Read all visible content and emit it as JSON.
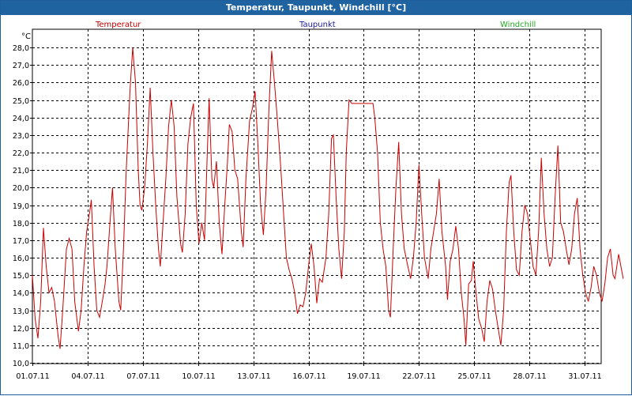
{
  "window": {
    "title": "Temperatur, Taupunkt, Windchill [°C]"
  },
  "colors": {
    "temperature": "#cc0000",
    "dewpoint": "#1a1aa0",
    "windchill": "#22aa22",
    "titlebar": "#1f63a0"
  },
  "chart_data": {
    "type": "line",
    "ylabel": "°C",
    "ylim": [
      10.0,
      28.5
    ],
    "yticks": [
      "10,0",
      "11,0",
      "12,0",
      "13,0",
      "14,0",
      "15,0",
      "16,0",
      "17,0",
      "18,0",
      "19,0",
      "20,0",
      "21,0",
      "22,0",
      "23,0",
      "24,0",
      "25,0",
      "26,0",
      "27,0",
      "28,0"
    ],
    "xticks": [
      "01.07.11",
      "04.07.11",
      "07.07.11",
      "10.07.11",
      "13.07.11",
      "16.07.11",
      "19.07.11",
      "22.07.11",
      "25.07.11",
      "28.07.11",
      "31.07.11"
    ],
    "xlim_days": [
      0,
      32.2
    ],
    "grid": true,
    "legend": [
      "Temperatur",
      "Taupunkt",
      "Windchill"
    ],
    "series": [
      {
        "name": "Temperatur",
        "points": [
          [
            0.0,
            15.0
          ],
          [
            0.15,
            12.5
          ],
          [
            0.3,
            11.4
          ],
          [
            0.45,
            13.5
          ],
          [
            0.6,
            17.7
          ],
          [
            0.75,
            15.5
          ],
          [
            0.9,
            14.0
          ],
          [
            1.05,
            14.3
          ],
          [
            1.2,
            13.5
          ],
          [
            1.4,
            11.5
          ],
          [
            1.5,
            10.8
          ],
          [
            1.65,
            13.0
          ],
          [
            1.85,
            16.5
          ],
          [
            2.0,
            17.1
          ],
          [
            2.15,
            16.5
          ],
          [
            2.3,
            13.5
          ],
          [
            2.5,
            11.8
          ],
          [
            2.65,
            13.0
          ],
          [
            2.8,
            15.5
          ],
          [
            2.95,
            17.5
          ],
          [
            3.1,
            18.5
          ],
          [
            3.2,
            19.3
          ],
          [
            3.35,
            15.5
          ],
          [
            3.5,
            13.0
          ],
          [
            3.65,
            12.6
          ],
          [
            3.8,
            13.5
          ],
          [
            3.95,
            14.5
          ],
          [
            4.05,
            15.5
          ],
          [
            4.2,
            17.8
          ],
          [
            4.35,
            20.0
          ],
          [
            4.5,
            16.5
          ],
          [
            4.7,
            13.5
          ],
          [
            4.8,
            13.0
          ],
          [
            4.95,
            16.5
          ],
          [
            5.1,
            21.0
          ],
          [
            5.3,
            25.5
          ],
          [
            5.45,
            28.0
          ],
          [
            5.6,
            26.0
          ],
          [
            5.75,
            21.0
          ],
          [
            5.85,
            19.0
          ],
          [
            5.95,
            18.7
          ],
          [
            6.1,
            20.0
          ],
          [
            6.25,
            22.5
          ],
          [
            6.4,
            25.7
          ],
          [
            6.55,
            22.0
          ],
          [
            6.7,
            19.0
          ],
          [
            6.85,
            16.5
          ],
          [
            6.95,
            15.5
          ],
          [
            7.1,
            18.0
          ],
          [
            7.25,
            20.5
          ],
          [
            7.4,
            23.5
          ],
          [
            7.55,
            25.0
          ],
          [
            7.7,
            23.5
          ],
          [
            7.85,
            19.5
          ],
          [
            8.05,
            16.8
          ],
          [
            8.15,
            16.3
          ],
          [
            8.3,
            18.5
          ],
          [
            8.45,
            22.5
          ],
          [
            8.6,
            24.0
          ],
          [
            8.75,
            24.8
          ],
          [
            8.9,
            19.0
          ],
          [
            9.05,
            16.8
          ],
          [
            9.2,
            18.0
          ],
          [
            9.35,
            17.0
          ],
          [
            9.5,
            22.0
          ],
          [
            9.6,
            25.1
          ],
          [
            9.75,
            20.5
          ],
          [
            9.85,
            20.0
          ],
          [
            10.0,
            21.5
          ],
          [
            10.15,
            18.0
          ],
          [
            10.3,
            16.2
          ],
          [
            10.45,
            19.0
          ],
          [
            10.6,
            21.5
          ],
          [
            10.7,
            23.6
          ],
          [
            10.85,
            23.2
          ],
          [
            11.0,
            21.0
          ],
          [
            11.15,
            20.5
          ],
          [
            11.35,
            17.5
          ],
          [
            11.45,
            16.6
          ],
          [
            11.6,
            20.5
          ],
          [
            11.8,
            23.8
          ],
          [
            11.95,
            24.5
          ],
          [
            12.1,
            25.5
          ],
          [
            12.25,
            22.5
          ],
          [
            12.4,
            19.0
          ],
          [
            12.55,
            17.3
          ],
          [
            12.7,
            20.0
          ],
          [
            12.85,
            24.5
          ],
          [
            13.0,
            27.8
          ],
          [
            13.15,
            26.0
          ],
          [
            13.3,
            24.0
          ],
          [
            13.5,
            21.0
          ],
          [
            13.65,
            18.5
          ],
          [
            13.8,
            16.0
          ],
          [
            13.95,
            15.3
          ],
          [
            14.1,
            14.8
          ],
          [
            14.25,
            14.0
          ],
          [
            14.4,
            12.8
          ],
          [
            14.55,
            13.3
          ],
          [
            14.7,
            13.2
          ],
          [
            14.85,
            14.0
          ],
          [
            15.0,
            15.5
          ],
          [
            15.15,
            16.8
          ],
          [
            15.3,
            15.5
          ],
          [
            15.45,
            13.4
          ],
          [
            15.6,
            14.8
          ],
          [
            15.75,
            14.6
          ],
          [
            15.95,
            16.0
          ],
          [
            16.1,
            18.5
          ],
          [
            16.25,
            22.8
          ],
          [
            16.35,
            23.0
          ],
          [
            16.5,
            19.5
          ],
          [
            16.65,
            16.5
          ],
          [
            16.8,
            14.8
          ],
          [
            16.95,
            17.5
          ],
          [
            17.05,
            22.0
          ],
          [
            17.2,
            25.0
          ],
          [
            17.35,
            24.8
          ],
          [
            17.8,
            24.8
          ],
          [
            18.2,
            24.8
          ],
          [
            18.5,
            24.8
          ],
          [
            18.6,
            24.0
          ],
          [
            18.75,
            22.0
          ],
          [
            18.9,
            18.0
          ],
          [
            19.05,
            16.5
          ],
          [
            19.2,
            15.5
          ],
          [
            19.35,
            13.0
          ],
          [
            19.45,
            12.6
          ],
          [
            19.6,
            16.5
          ],
          [
            19.75,
            20.0
          ],
          [
            19.9,
            22.6
          ],
          [
            20.05,
            18.5
          ],
          [
            20.2,
            16.5
          ],
          [
            20.4,
            15.5
          ],
          [
            20.55,
            14.8
          ],
          [
            20.7,
            16.0
          ],
          [
            20.85,
            18.0
          ],
          [
            21.0,
            21.3
          ],
          [
            21.15,
            18.5
          ],
          [
            21.3,
            16.0
          ],
          [
            21.5,
            14.8
          ],
          [
            21.65,
            16.5
          ],
          [
            21.8,
            17.5
          ],
          [
            21.95,
            18.5
          ],
          [
            22.1,
            20.5
          ],
          [
            22.25,
            17.5
          ],
          [
            22.45,
            15.5
          ],
          [
            22.55,
            13.6
          ],
          [
            22.7,
            15.8
          ],
          [
            22.85,
            16.5
          ],
          [
            23.0,
            17.8
          ],
          [
            23.15,
            16.5
          ],
          [
            23.3,
            14.0
          ],
          [
            23.45,
            12.5
          ],
          [
            23.55,
            11.0
          ],
          [
            23.7,
            14.5
          ],
          [
            23.85,
            14.7
          ],
          [
            23.95,
            15.8
          ],
          [
            24.1,
            14.0
          ],
          [
            24.25,
            12.5
          ],
          [
            24.4,
            12.0
          ],
          [
            24.55,
            11.2
          ],
          [
            24.7,
            13.5
          ],
          [
            24.85,
            14.7
          ],
          [
            25.0,
            14.2
          ],
          [
            25.15,
            13.0
          ],
          [
            25.3,
            12.0
          ],
          [
            25.45,
            11.0
          ],
          [
            25.6,
            13.0
          ],
          [
            25.75,
            17.5
          ],
          [
            25.9,
            20.3
          ],
          [
            26.0,
            20.7
          ],
          [
            26.15,
            17.5
          ],
          [
            26.3,
            15.3
          ],
          [
            26.45,
            15.0
          ],
          [
            26.6,
            17.5
          ],
          [
            26.75,
            19.0
          ],
          [
            26.9,
            18.5
          ],
          [
            27.05,
            17.0
          ],
          [
            27.2,
            15.5
          ],
          [
            27.35,
            15.0
          ],
          [
            27.5,
            17.5
          ],
          [
            27.65,
            21.7
          ],
          [
            27.8,
            18.5
          ],
          [
            27.95,
            16.5
          ],
          [
            28.1,
            15.5
          ],
          [
            28.25,
            16.0
          ],
          [
            28.4,
            19.5
          ],
          [
            28.55,
            22.4
          ],
          [
            28.7,
            18.0
          ],
          [
            28.85,
            17.5
          ],
          [
            29.0,
            16.5
          ],
          [
            29.15,
            15.6
          ],
          [
            29.3,
            16.5
          ],
          [
            29.45,
            18.5
          ],
          [
            29.6,
            19.4
          ],
          [
            29.75,
            16.5
          ],
          [
            29.9,
            15.0
          ],
          [
            30.05,
            14.0
          ],
          [
            30.2,
            13.5
          ],
          [
            30.35,
            14.3
          ],
          [
            30.5,
            15.5
          ],
          [
            30.65,
            15.0
          ],
          [
            30.8,
            14.0
          ],
          [
            30.95,
            13.5
          ],
          [
            31.1,
            14.5
          ],
          [
            31.25,
            16.0
          ],
          [
            31.4,
            16.5
          ],
          [
            31.55,
            15.0
          ],
          [
            31.65,
            14.8
          ],
          [
            31.85,
            16.2
          ],
          [
            32.1,
            14.8
          ]
        ]
      }
    ]
  }
}
